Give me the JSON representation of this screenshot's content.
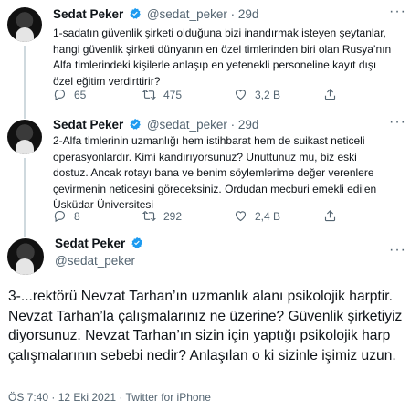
{
  "tweets": [
    {
      "name": "Sedat Peker",
      "handle": "@sedat_peker",
      "dot": "·",
      "time": "29d",
      "text": "1-sadatın güvenlik şirketi olduğuna bizi inandırmak isteyen şeytanlar, hangi güvenlik şirketi dünyanın en özel timlerinden biri olan Rusya’nın Alfa timlerindeki kişilerle anlaşıp en yetenekli personeline kayıt dışı özel eğitim verdirttirir?",
      "replies": "65",
      "retweets": "475",
      "likes": "3,2 B"
    },
    {
      "name": "Sedat Peker",
      "handle": "@sedat_peker",
      "dot": "·",
      "time": "29d",
      "text": "2-Alfa timlerinin uzmanlığı hem istihbarat hem de suikast neticeli operasyonlardır. Kimi kandırıyorsunuz? Unuttunuz mu, biz eski dostuz. Ancak rotayı bana ve benim söylemlerime değer verenlere çevirmenin neticesini göreceksiniz. Ordudan mecburi emekli edilen Üsküdar Üniversitesi",
      "replies": "8",
      "retweets": "292",
      "likes": "2,4 B"
    }
  ],
  "main_tweet": {
    "name": "Sedat Peker",
    "handle": "@sedat_peker",
    "text": "3-...rektörü Nevzat Tarhan’ın uzmanlık alanı psikolojik harptir. Nevzat Tarhan’la çalışmalarınız ne üzerine? Güvenlik şirketiyiz diyorsunuz. Nevzat Tarhan’ın sizin için yaptığı psikolojik harp çalışmalarının sebebi nedir? Anlaşılan o ki sizinle işimiz uzun.",
    "timestamp": "ÖS 7:40 · 12 Eki 2021 · Twitter for iPhone"
  },
  "more_label": "···",
  "colors": {
    "verified": "#1d9bf0",
    "muted": "#536471",
    "text": "#0f1419"
  }
}
